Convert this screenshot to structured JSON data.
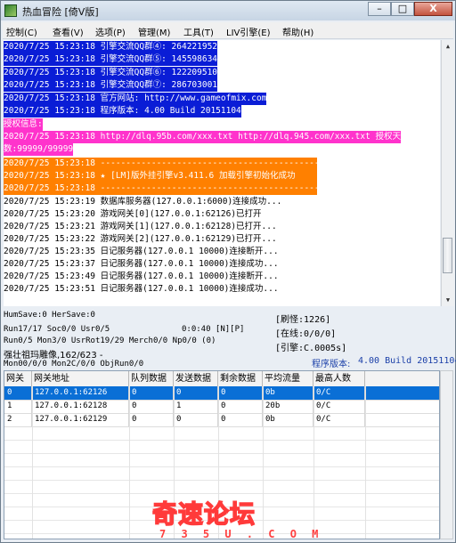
{
  "window": {
    "title": "热血冒险 [倚V版]",
    "min_glyph": "–",
    "max_glyph": "□",
    "close_glyph": "X"
  },
  "menu": [
    "控制(C)",
    "查看(V)",
    "选项(P)",
    "管理(M)",
    "工具(T)",
    "LIV引擎(E)",
    "帮助(H)"
  ],
  "log": {
    "lines": [
      "2020/7/25 15:23:18 引擎交流QQ群④: 264221952",
      "2020/7/25 15:23:18 引擎交流QQ群⑤: 145598634",
      "2020/7/25 15:23:18 引擎交流QQ群⑥: 122209510",
      "2020/7/25 15:23:18 引擎交流QQ群⑦: 286703001",
      "2020/7/25 15:23:18 官方网站: http://www.gameofmix.com",
      "2020/7/25 15:23:18 程序版本: 4.00 Build 20151104",
      "授权信息:",
      "2020/7/25 15:23:18 http://dlq.95b.com/xxx.txt http://dlq.945.com/xxx.txt 授权天",
      "数:99999/99999",
      "2020/7/25 15:23:18 ---------------------------------------------------",
      "2020/7/25 15:23:18 ★ [LM]版外挂引擎v3.411.6 加载引擎初始化成功",
      "2020/7/25 15:23:18 ---------------------------------------------------",
      "2020/7/25 15:23:19 数据库服务器(127.0.0.1:6000)连接成功...",
      "2020/7/25 15:23:20 游戏网关[0](127.0.0.1:62126)已打开",
      "2020/7/25 15:23:21 游戏网关[1](127.0.0.1:62128)已打开...",
      "2020/7/25 15:23:22 游戏网关[2](127.0.0.1:62129)已打开...",
      "2020/7/25 15:23:35 日记服务器(127.0.0.1 10000)连接断开...",
      "2020/7/25 15:23:37 日记服务器(127.0.0.1 10000)连接成功...",
      "2020/7/25 15:23:49 日记服务器(127.0.0.1 10000)连接断开...",
      "2020/7/25 15:23:51 日记服务器(127.0.0.1 10000)连接成功..."
    ]
  },
  "status": {
    "line1": "HumSave:0 HerSave:0",
    "line2": "Run17/17 Soc0/0 Usr0/5",
    "line2b": "0:0:40 [N][P]",
    "line3": "Run0/5 Mon3/0 UsrRot19/29 Merch0/0 Np0/0 (0)",
    "line4": "强壮祖玛雕像,162/623 -",
    "line5": "Mon00/0/0 Mon2C/0/0 ObjRun0/0",
    "refresh": "[刷怪:1226]",
    "online": "[在线:0/0/0]",
    "engine": "[引擎:C.0005s]",
    "version_label": "程序版本:",
    "version": "4.00 Build 20151104"
  },
  "gates": {
    "columns": [
      "网关",
      "网关地址",
      "队列数据",
      "发送数据",
      "剩余数据",
      "平均流量",
      "最高人数"
    ],
    "rows": [
      [
        "0",
        "127.0.0.1:62126",
        "0",
        "0",
        "0",
        "0b",
        "0/C"
      ],
      [
        "1",
        "127.0.0.1:62128",
        "0",
        "1",
        "0",
        "20b",
        "0/C"
      ],
      [
        "2",
        "127.0.0.1:62129",
        "0",
        "0",
        "0",
        "0b",
        "0/C"
      ]
    ]
  },
  "watermark": {
    "main": "奇速论坛",
    "sub": "7 3 5 U . C O M"
  }
}
